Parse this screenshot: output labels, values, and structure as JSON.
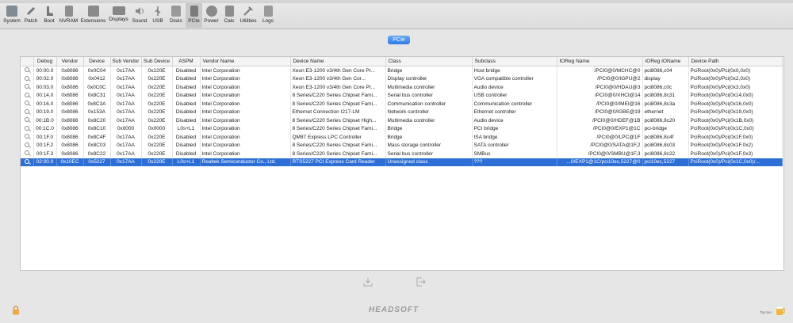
{
  "toolbar": {
    "items": [
      {
        "label": "System",
        "icon": "system-icon"
      },
      {
        "label": "Patch",
        "icon": "patch-icon"
      },
      {
        "label": "Boot",
        "icon": "boot-icon"
      },
      {
        "label": "NVRAM",
        "icon": "nvram-icon"
      },
      {
        "label": "Extensions",
        "icon": "extensions-icon"
      },
      {
        "label": "Displays",
        "icon": "displays-icon"
      },
      {
        "label": "Sound",
        "icon": "sound-icon"
      },
      {
        "label": "USB",
        "icon": "usb-icon"
      },
      {
        "label": "Disks",
        "icon": "disks-icon"
      },
      {
        "label": "PCIe",
        "icon": "pcie-icon"
      },
      {
        "label": "Power",
        "icon": "power-icon"
      },
      {
        "label": "Calc",
        "icon": "calc-icon"
      },
      {
        "label": "Utilities",
        "icon": "utilities-icon"
      },
      {
        "label": "Logs",
        "icon": "logs-icon"
      }
    ],
    "active": "PCIe"
  },
  "section_button": "PCIe",
  "table": {
    "columns": [
      "",
      "Debug",
      "Vendor",
      "Device",
      "Sub Vendor",
      "Sub Device",
      "ASPM",
      "Vendor Name",
      "Device Name",
      "Class",
      "Subclass",
      "IOReg Name",
      "IOReg IOName",
      "Device Path"
    ],
    "rows": [
      [
        "00:00.0",
        "0x8086",
        "0x0C04",
        "0x17AA",
        "0x220E",
        "Disabled",
        "Intel Corporation",
        "Xeon E3-1200 v3/4th Gen Core Pr...",
        "Bridge",
        "Host bridge",
        "/PCI0@0/MCHC@0",
        "pci8086,c04",
        "PciRoot(0x0)/Pci(0x0,0x0)"
      ],
      [
        "00:02.0",
        "0x8086",
        "0x0412",
        "0x17AA",
        "0x220E",
        "Disabled",
        "Intel Corporation",
        "Xeon E3-1200 v3/4th Gen Cor...",
        "Display controller",
        "VGA compatible controller",
        "/PCI0@0/IGPU@2",
        "display",
        "PciRoot(0x0)/Pci(0x2,0x0)"
      ],
      [
        "00:03.0",
        "0x8086",
        "0x0C0C",
        "0x17AA",
        "0x220E",
        "Disabled",
        "Intel Corporation",
        "Xeon E3-1200 v3/4th Gen Core Pr...",
        "Multimedia controller",
        "Audio device",
        "/PCI0@0/HDAU@3",
        "pci8086,c0c",
        "PciRoot(0x0)/Pci(0x3,0x0)"
      ],
      [
        "00:14.0",
        "0x8086",
        "0x8C31",
        "0x17AA",
        "0x220E",
        "Disabled",
        "Intel Corporation",
        "8 Series/C220 Series Chipset Fami...",
        "Serial bus controller",
        "USB controller",
        "/PCI0@0/XHCI@14",
        "pci8086,8c31",
        "PciRoot(0x0)/Pci(0x14,0x0)"
      ],
      [
        "00:16.0",
        "0x8086",
        "0x8C3A",
        "0x17AA",
        "0x220E",
        "Disabled",
        "Intel Corporation",
        "8 Series/C220 Series Chipset Fami...",
        "Communication controller",
        "Communication controller",
        "/PCI0@0/IMEI@16",
        "pci8086,8c3a",
        "PciRoot(0x0)/Pci(0x16,0x0)"
      ],
      [
        "00:19.0",
        "0x8086",
        "0x153A",
        "0x17AA",
        "0x220E",
        "Disabled",
        "Intel Corporation",
        "Ethernet Connection I217-LM",
        "Network controller",
        "Ethernet controller",
        "/PCI0@0/IGBE@19",
        "ethernet",
        "PciRoot(0x0)/Pci(0x19,0x0)"
      ],
      [
        "00:1B.0",
        "0x8086",
        "0x8C20",
        "0x17AA",
        "0x220E",
        "Disabled",
        "Intel Corporation",
        "8 Series/C220 Series Chipset High...",
        "Multimedia controller",
        "Audio device",
        "/PCI0@0/HDEF@1B",
        "pci8086,8c20",
        "PciRoot(0x0)/Pci(0x1B,0x0)"
      ],
      [
        "00:1C.0",
        "0x8086",
        "0x8C10",
        "0x0000",
        "0x0000",
        "L0s+L1",
        "Intel Corporation",
        "8 Series/C220 Series Chipset Fami...",
        "Bridge",
        "PCI bridge",
        "/PCI0@0/EXP1@1C",
        "pci-bridge",
        "PciRoot(0x0)/Pci(0x1C,0x0)"
      ],
      [
        "00:1F.0",
        "0x8086",
        "0x8C4F",
        "0x17AA",
        "0x220E",
        "Disabled",
        "Intel Corporation",
        "QM87 Express LPC Controller",
        "Bridge",
        "ISA bridge",
        "/PCI0@0/LPC@1F",
        "pci8086,8c4f",
        "PciRoot(0x0)/Pci(0x1F,0x0)"
      ],
      [
        "00:1F.2",
        "0x8086",
        "0x8C03",
        "0x17AA",
        "0x220E",
        "Disabled",
        "Intel Corporation",
        "8 Series/C220 Series Chipset Fami...",
        "Mass storage controller",
        "SATA controller",
        "/PCI0@0/SATA@1F,2",
        "pci8086,8c03",
        "PciRoot(0x0)/Pci(0x1F,0x2)"
      ],
      [
        "00:1F.3",
        "0x8086",
        "0x8C22",
        "0x17AA",
        "0x220E",
        "Disabled",
        "Intel Corporation",
        "8 Series/C220 Series Chipset Fami...",
        "Serial bus controller",
        "SMBus",
        "/PCI0@0/SMBU@1F,3",
        "pci8086,8c22",
        "PciRoot(0x0)/Pci(0x1F,0x3)"
      ],
      [
        "02:00.0",
        "0x10EC",
        "0x5227",
        "0x17AA",
        "0x220E",
        "L0s+L1",
        "Realtek Semiconductor Co., Ltd.",
        "RTS5227 PCI Express Card Reader",
        "Unassigned class",
        "???",
        "...0/EXP1@1C/pci10ec,5227@0",
        "pci10ec,5227",
        "PciRoot(0x0)/Pci(0x1C,0x0)/..."
      ]
    ],
    "selected_row": 11
  },
  "footer": {
    "logo": "HEADSOFT",
    "tip_label": "Tip me!"
  },
  "colors": {
    "accent": "#2d6fd6",
    "toolbar_bg": "#e0e0e0",
    "window_bg": "#e6e6e6"
  }
}
